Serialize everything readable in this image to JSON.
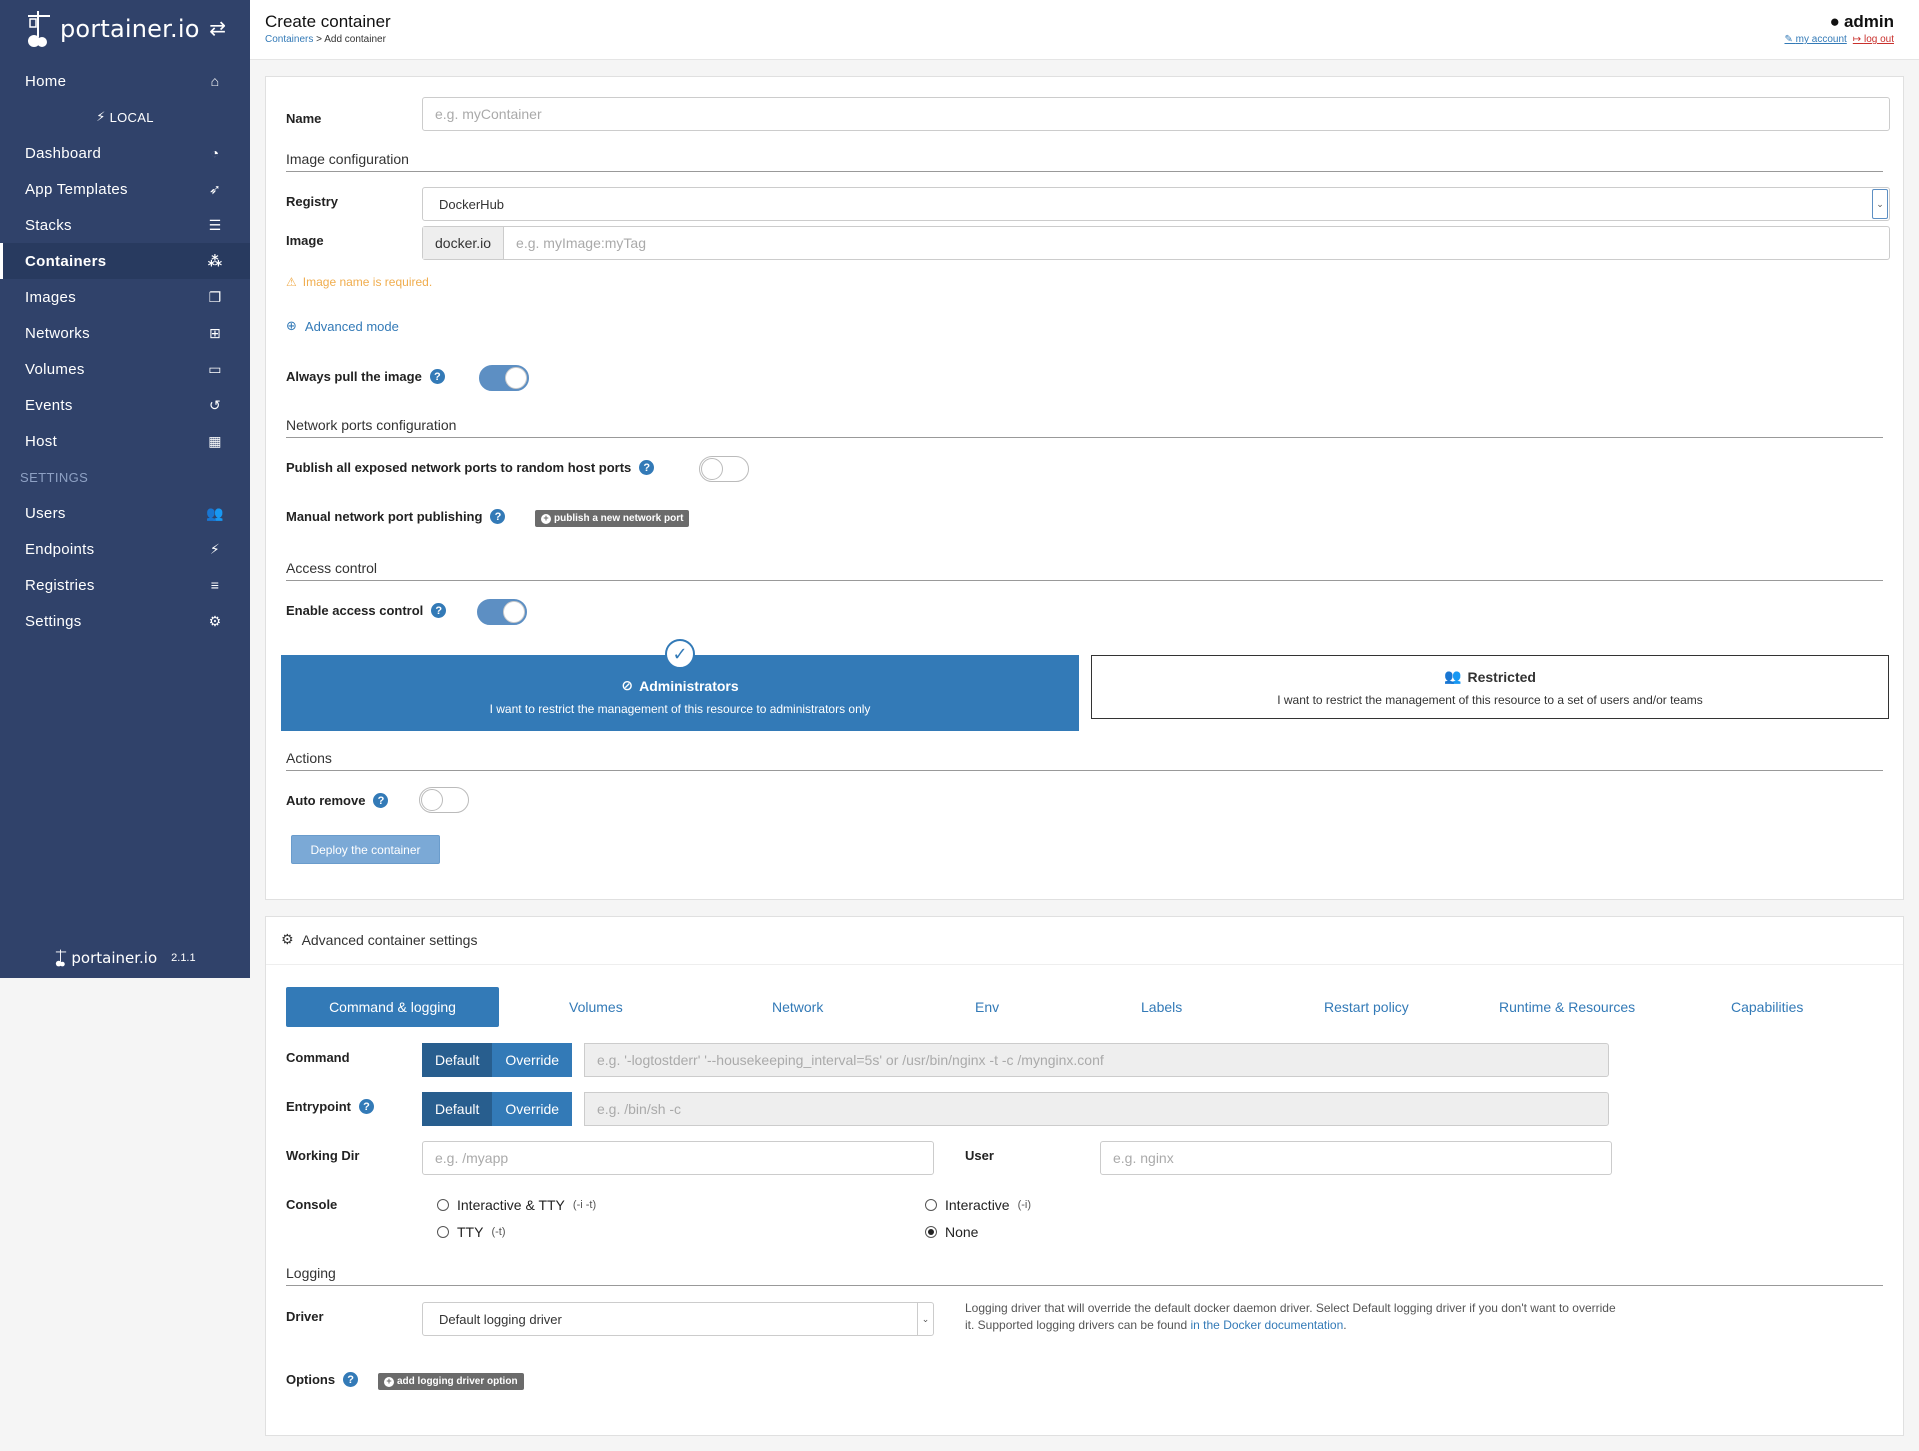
{
  "sidebar": {
    "brand": "portainer.io",
    "items": [
      {
        "label": "Home",
        "icon": "home-icon"
      },
      {
        "label": "Dashboard",
        "icon": "dashboard-icon"
      },
      {
        "label": "App Templates",
        "icon": "rocket-icon"
      },
      {
        "label": "Stacks",
        "icon": "stacks-icon"
      },
      {
        "label": "Containers",
        "icon": "cubes-icon"
      },
      {
        "label": "Images",
        "icon": "images-icon"
      },
      {
        "label": "Networks",
        "icon": "sitemap-icon"
      },
      {
        "label": "Volumes",
        "icon": "hdd-icon"
      },
      {
        "label": "Events",
        "icon": "history-icon"
      },
      {
        "label": "Host",
        "icon": "grid-icon"
      },
      {
        "label": "Users",
        "icon": "users-icon"
      },
      {
        "label": "Endpoints",
        "icon": "plug-icon"
      },
      {
        "label": "Registries",
        "icon": "database-icon"
      },
      {
        "label": "Settings",
        "icon": "cogs-icon"
      }
    ],
    "endpoint": "LOCAL",
    "settings_heading": "SETTINGS",
    "footer_brand": "portainer.io",
    "version": "2.1.1"
  },
  "header": {
    "title": "Create container",
    "breadcrumb_link": "Containers",
    "breadcrumb_current": "> Add container",
    "user": "admin",
    "my_account": "my account",
    "log_out": "log out"
  },
  "form": {
    "name_label": "Name",
    "name_placeholder": "e.g. myContainer",
    "image_section": "Image configuration",
    "registry_label": "Registry",
    "registry_value": "DockerHub",
    "image_label": "Image",
    "image_prefix": "docker.io",
    "image_placeholder": "e.g. myImage:myTag",
    "image_warning": "Image name is required.",
    "advanced_mode": "Advanced mode",
    "always_pull_label": "Always pull the image",
    "ports_section": "Network ports configuration",
    "publish_all_label": "Publish all exposed network ports to random host ports",
    "manual_publish_label": "Manual network port publishing",
    "publish_new_port": "publish a new network port",
    "access_section": "Access control",
    "enable_access_label": "Enable access control",
    "admin_title": "Administrators",
    "admin_desc": "I want to restrict the management of this resource to administrators only",
    "restricted_title": "Restricted",
    "restricted_desc": "I want to restrict the management of this resource to a set of users and/or teams",
    "actions_section": "Actions",
    "auto_remove_label": "Auto remove",
    "deploy_button": "Deploy the container"
  },
  "advanced": {
    "title": "Advanced container settings",
    "tabs": [
      "Command & logging",
      "Volumes",
      "Network",
      "Env",
      "Labels",
      "Restart policy",
      "Runtime & Resources",
      "Capabilities"
    ],
    "command_label": "Command",
    "entrypoint_label": "Entrypoint",
    "default_btn": "Default",
    "override_btn": "Override",
    "command_placeholder": "e.g. '-logtostderr' '--housekeeping_interval=5s' or /usr/bin/nginx -t -c /mynginx.conf",
    "entrypoint_placeholder": "e.g. /bin/sh -c",
    "workdir_label": "Working Dir",
    "workdir_placeholder": "e.g. /myapp",
    "user_label": "User",
    "user_placeholder": "e.g. nginx",
    "console_label": "Console",
    "console_options": [
      {
        "label": "Interactive & TTY",
        "sub": "(-i -t)",
        "selected": false
      },
      {
        "label": "Interactive",
        "sub": "(-i)",
        "selected": false
      },
      {
        "label": "TTY",
        "sub": "(-t)",
        "selected": false
      },
      {
        "label": "None",
        "sub": "",
        "selected": true
      }
    ],
    "logging_section": "Logging",
    "driver_label": "Driver",
    "driver_value": "Default logging driver",
    "driver_help_1": "Logging driver that will override the default docker daemon driver. Select Default logging driver if you don't want to override it. Supported logging drivers can be found",
    "driver_help_link": "in the Docker documentation",
    "driver_help_end": ".",
    "options_label": "Options",
    "add_option": "add logging driver option"
  },
  "colors": {
    "sidebar": "#30426a",
    "accent": "#337ab7",
    "warning": "#f0ad4e"
  }
}
